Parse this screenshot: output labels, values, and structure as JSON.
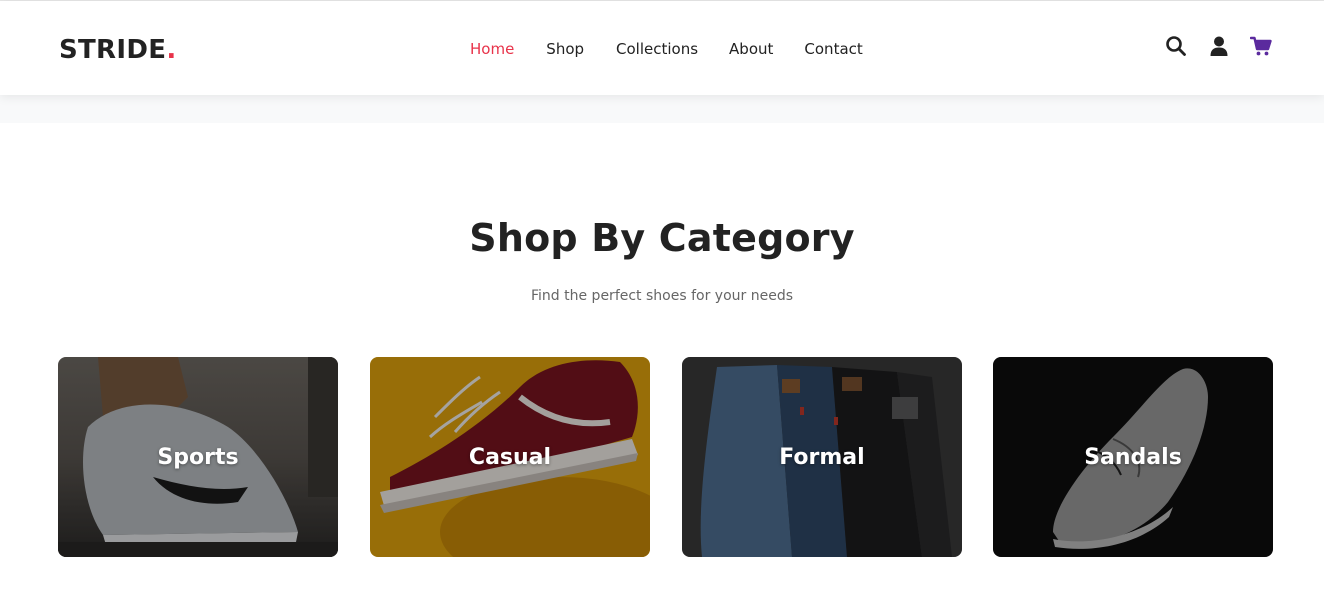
{
  "brand": {
    "name": "STRIDE",
    "dot": ".",
    "accent": "#e8334a"
  },
  "nav": {
    "items": [
      {
        "label": "Home"
      },
      {
        "label": "Shop"
      },
      {
        "label": "Collections"
      },
      {
        "label": "About"
      },
      {
        "label": "Contact"
      }
    ],
    "active": "Home"
  },
  "header_icons": [
    {
      "name": "search-icon"
    },
    {
      "name": "user-icon"
    },
    {
      "name": "cart-icon",
      "color": "#5b2a9e"
    }
  ],
  "section": {
    "title": "Shop By Category",
    "subtitle": "Find the perfect shoes for your needs"
  },
  "categories": [
    {
      "label": "Sports"
    },
    {
      "label": "Casual"
    },
    {
      "label": "Formal"
    },
    {
      "label": "Sandals"
    }
  ]
}
